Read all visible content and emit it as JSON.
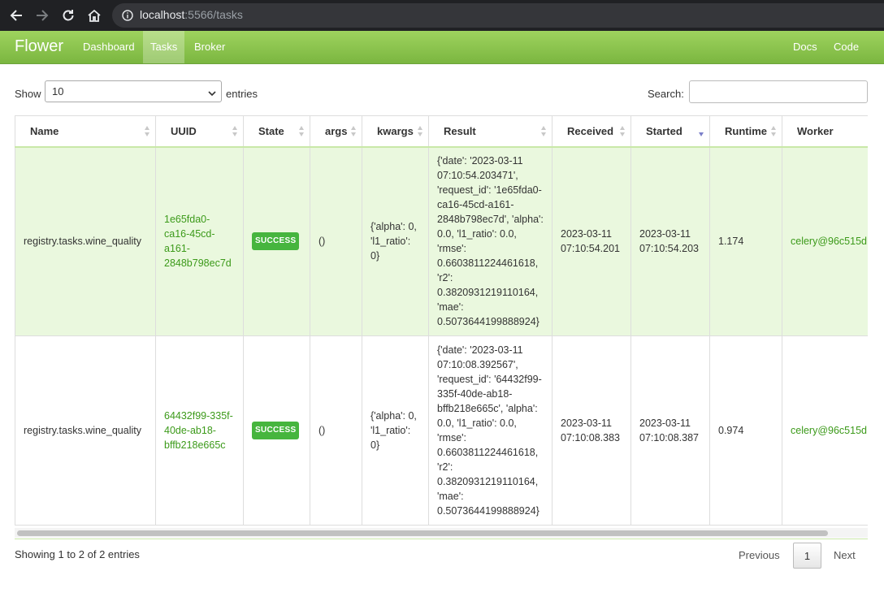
{
  "browser": {
    "url_host": "localhost",
    "url_rest": ":5566/tasks"
  },
  "navbar": {
    "brand": "Flower",
    "links": [
      "Dashboard",
      "Tasks",
      "Broker"
    ],
    "right_links": [
      "Docs",
      "Code"
    ],
    "active": "Tasks"
  },
  "controls": {
    "show_label": "Show",
    "page_size": "10",
    "entries_label": "entries",
    "search_label": "Search:",
    "search_value": ""
  },
  "table": {
    "columns": [
      "Name",
      "UUID",
      "State",
      "args",
      "kwargs",
      "Result",
      "Received",
      "Started",
      "Runtime",
      "Worker"
    ],
    "sorted_column": "Started",
    "rows": [
      {
        "name": "registry.tasks.wine_quality",
        "uuid": "1e65fda0-ca16-45cd-a161-2848b798ec7d",
        "state": "SUCCESS",
        "args": "()",
        "kwargs": "{'alpha': 0, 'l1_ratio': 0}",
        "result": "{'date': '2023-03-11 07:10:54.203471', 'request_id': '1e65fda0-ca16-45cd-a161-2848b798ec7d', 'alpha': 0.0, 'l1_ratio': 0.0, 'rmse': 0.6603811224461618, 'r2': 0.3820931219110164, 'mae': 0.5073644199888924}",
        "received": "2023-03-11 07:10:54.201",
        "started": "2023-03-11 07:10:54.203",
        "runtime": "1.174",
        "worker": "celery@96c515d"
      },
      {
        "name": "registry.tasks.wine_quality",
        "uuid": "64432f99-335f-40de-ab18-bffb218e665c",
        "state": "SUCCESS",
        "args": "()",
        "kwargs": "{'alpha': 0, 'l1_ratio': 0}",
        "result": "{'date': '2023-03-11 07:10:08.392567', 'request_id': '64432f99-335f-40de-ab18-bffb218e665c', 'alpha': 0.0, 'l1_ratio': 0.0, 'rmse': 0.6603811224461618, 'r2': 0.3820931219110164, 'mae': 0.5073644199888924}",
        "received": "2023-03-11 07:10:08.383",
        "started": "2023-03-11 07:10:08.387",
        "runtime": "0.974",
        "worker": "celery@96c515d"
      }
    ]
  },
  "footer": {
    "info": "Showing 1 to 2 of 2 entries",
    "previous": "Previous",
    "current_page": "1",
    "next": "Next"
  },
  "colors": {
    "navbar": "#8cc34f",
    "success_badge": "#46b53e",
    "link": "#3c9a1a",
    "row_highlight": "#eaf8de"
  }
}
